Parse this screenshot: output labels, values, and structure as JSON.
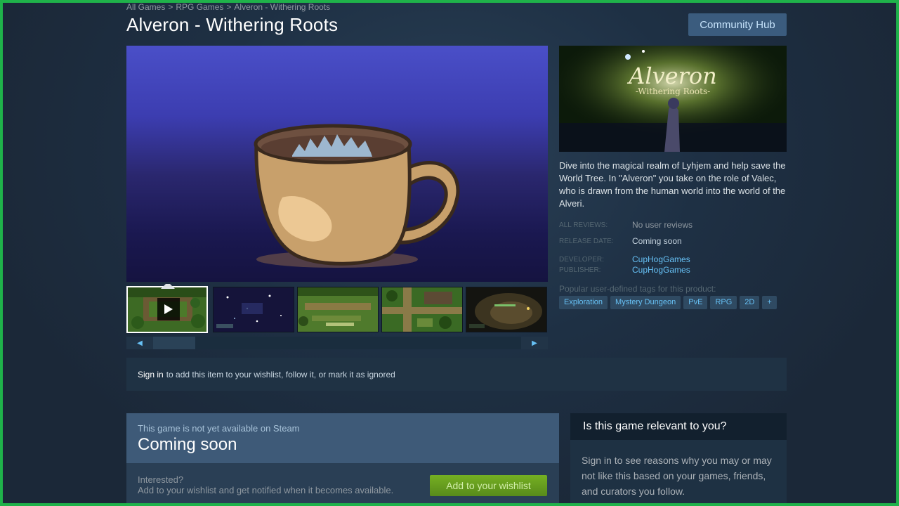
{
  "breadcrumb": [
    "All Games",
    "RPG Games",
    "Alveron - Withering Roots"
  ],
  "header": {
    "title": "Alveron - Withering Roots",
    "community_hub": "Community Hub"
  },
  "media": {
    "thumbnails": [
      "video-thumbnail",
      "screenshot-1",
      "screenshot-2",
      "screenshot-3",
      "screenshot-4"
    ],
    "scroll_left": "◀",
    "scroll_right": "▶"
  },
  "side": {
    "capsule_title": "Alveron",
    "capsule_subtitle": "-Withering Roots-",
    "description": "Dive into the magical realm of Lyhjem and help save the World Tree. In \"Alveron\" you take on the role of Valec, who is drawn from the human world into the world of the Alveri.",
    "reviews_label": "ALL REVIEWS:",
    "reviews_value": "No user reviews",
    "release_label": "RELEASE DATE:",
    "release_value": "Coming soon",
    "developer_label": "DEVELOPER:",
    "developer_value": "CupHogGames",
    "publisher_label": "PUBLISHER:",
    "publisher_value": "CupHogGames",
    "tags_label": "Popular user-defined tags for this product:",
    "tags": [
      "Exploration",
      "Mystery Dungeon",
      "PvE",
      "RPG",
      "2D",
      "+"
    ]
  },
  "signin": {
    "link": "Sign in",
    "text": "to add this item to your wishlist, follow it, or mark it as ignored"
  },
  "purchase": {
    "note": "This game is not yet available on Steam",
    "title": "Coming soon",
    "interested": "Interested?",
    "interested_sub": "Add to your wishlist and get notified when it becomes available.",
    "wishlist_button": "Add to your wishlist"
  },
  "relevance": {
    "heading": "Is this game relevant to you?",
    "body": "Sign in to see reasons why you may or may not like this based on your games, friends, and curators you follow."
  },
  "colors": {
    "background": "#1b2838",
    "link": "#66c0f4",
    "wishlist_green": "#75b022",
    "frame": "#1fb24a"
  }
}
